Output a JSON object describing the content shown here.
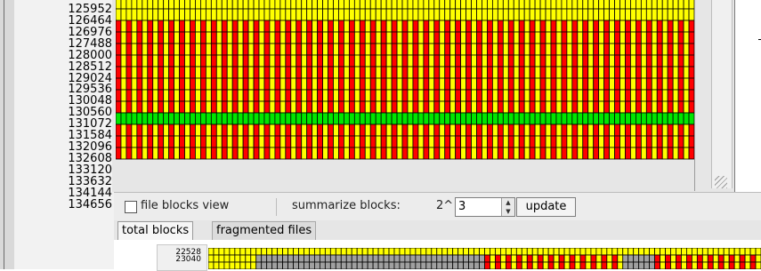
{
  "upper_map": {
    "row_labels": [
      "125952",
      "126464",
      "126976",
      "127488",
      "128000",
      "128512",
      "129024",
      "129536",
      "130048",
      "130560",
      "131072",
      "131584",
      "132096",
      "132608",
      "133120",
      "133632",
      "134144",
      "134656"
    ],
    "row_types": [
      "yellow",
      "yellow",
      "stripe",
      "stripe",
      "stripe",
      "stripe",
      "stripe",
      "stripe",
      "stripe",
      "stripe",
      "green",
      "stripe",
      "stripe",
      "stripe"
    ]
  },
  "toolbar": {
    "file_blocks_label": "file blocks view",
    "summarize_label": "summarize blocks:",
    "summarize_prefix": "2^",
    "summarize_value": "3",
    "update_label": "update"
  },
  "tabs": {
    "total_blocks": "total blocks",
    "fragmented_files": "fragmented files"
  },
  "lower_map": {
    "row_labels": [
      "22528",
      "23040"
    ]
  },
  "colors": {
    "used": "#ffff00",
    "fragmented": "#ff0000",
    "selected": "#00e600",
    "free": "#a0a0a0",
    "grid": "#000000"
  }
}
